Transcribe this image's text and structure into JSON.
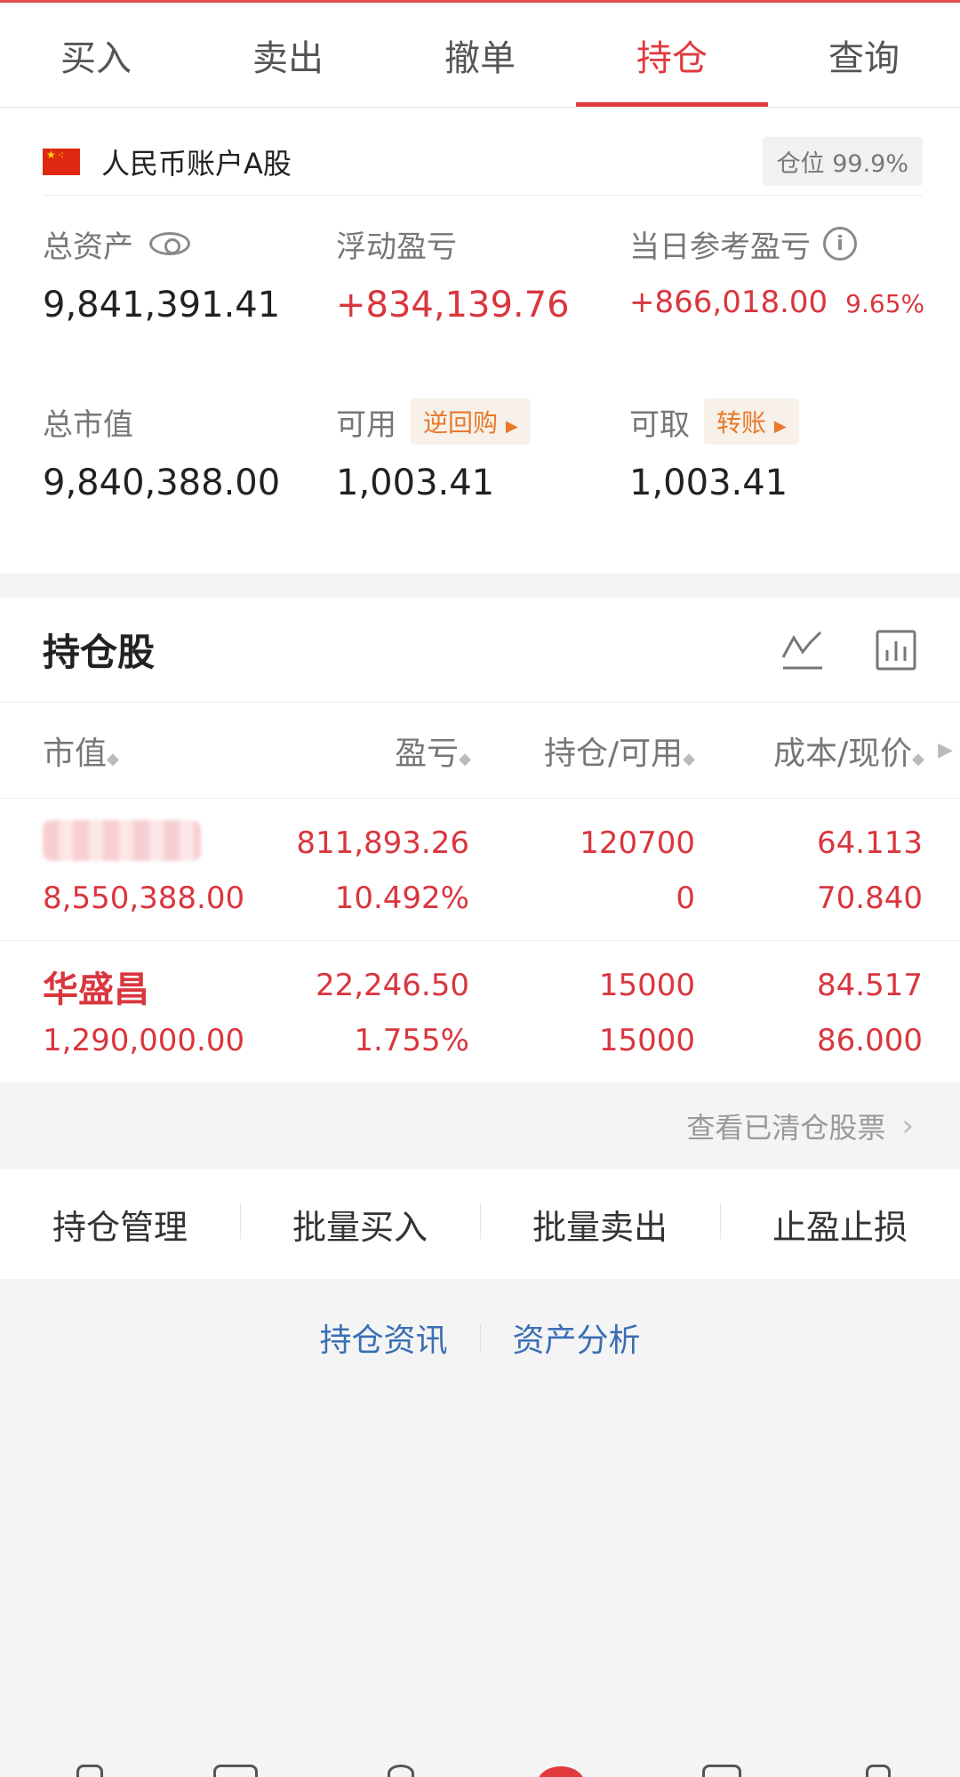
{
  "tabs": [
    {
      "label": "买入"
    },
    {
      "label": "卖出"
    },
    {
      "label": "撤单"
    },
    {
      "label": "持仓"
    },
    {
      "label": "查询"
    }
  ],
  "active_tab": "持仓",
  "account": {
    "name": "人民币账户A股",
    "position_ratio": "仓位 99.9%"
  },
  "summary": {
    "total_assets": {
      "label": "总资产",
      "value": "9,841,391.41"
    },
    "floating_pnl": {
      "label": "浮动盈亏",
      "value": "+834,139.76"
    },
    "daily_pnl": {
      "label": "当日参考盈亏",
      "value": "+866,018.00",
      "pct": "9.65%"
    },
    "market_value": {
      "label": "总市值",
      "value": "9,840,388.00"
    },
    "available": {
      "label": "可用",
      "value": "1,003.41",
      "tag": "逆回购"
    },
    "withdrawable": {
      "label": "可取",
      "value": "1,003.41",
      "tag": "转账"
    }
  },
  "holdings": {
    "title": "持仓股",
    "columns": [
      "市值",
      "盈亏",
      "持仓/可用",
      "成本/现价"
    ],
    "rows": [
      {
        "name": "",
        "market_value": "8,550,388.00",
        "pnl": "811,893.26",
        "pnl_pct": "10.492%",
        "position": "120700",
        "available": "0",
        "cost": "64.113",
        "price": "70.840"
      },
      {
        "name": "华盛昌",
        "market_value": "1,290,000.00",
        "pnl": "22,246.50",
        "pnl_pct": "1.755%",
        "position": "15000",
        "available": "15000",
        "cost": "84.517",
        "price": "86.000"
      }
    ]
  },
  "cleared_link": "查看已清仓股票",
  "actions": [
    "持仓管理",
    "批量买入",
    "批量卖出",
    "止盈止损"
  ],
  "links": [
    "持仓资讯",
    "资产分析"
  ],
  "colors": {
    "accent": "#e0393e",
    "gain": "#d9363e",
    "link": "#3a6fb5",
    "tag": "#e8792a"
  },
  "icons": [
    "eye-icon",
    "info-icon",
    "line-chart-icon",
    "bar-chart-icon",
    "chevron-right-icon",
    "sort-icon"
  ]
}
